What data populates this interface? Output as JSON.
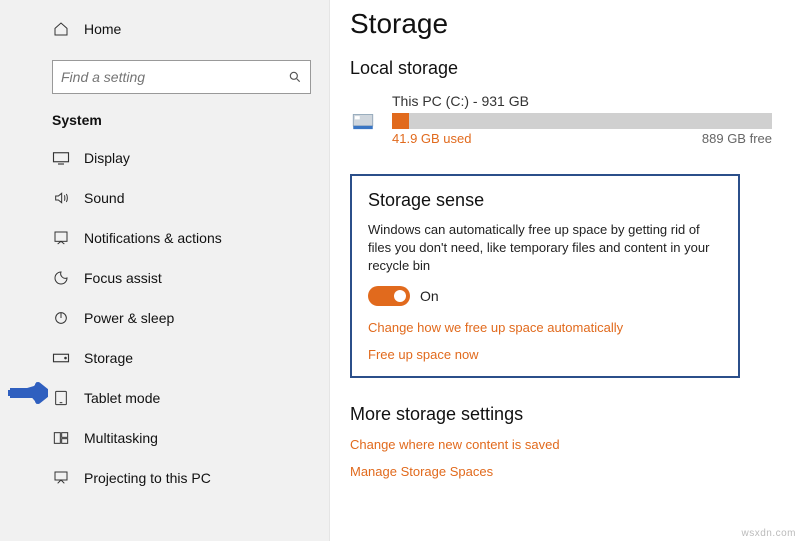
{
  "sidebar": {
    "home": "Home",
    "search_placeholder": "Find a setting",
    "section": "System",
    "items": [
      {
        "label": "Display"
      },
      {
        "label": "Sound"
      },
      {
        "label": "Notifications & actions"
      },
      {
        "label": "Focus assist"
      },
      {
        "label": "Power & sleep"
      },
      {
        "label": "Storage"
      },
      {
        "label": "Tablet mode"
      },
      {
        "label": "Multitasking"
      },
      {
        "label": "Projecting to this PC"
      }
    ]
  },
  "main": {
    "title": "Storage",
    "local_heading": "Local storage",
    "drive": {
      "name": "This PC (C:) - 931 GB",
      "used_label": "41.9 GB used",
      "free_label": "889 GB free",
      "used_pct": 4.5
    },
    "sense": {
      "heading": "Storage sense",
      "desc": "Windows can automatically free up space by getting rid of files you don't need, like temporary files and content in your recycle bin",
      "toggle_state": "On",
      "link_change": "Change how we free up space automatically",
      "link_free": "Free up space now"
    },
    "more": {
      "heading": "More storage settings",
      "link_change_save": "Change where new content is saved",
      "link_manage": "Manage Storage Spaces"
    }
  },
  "watermark": "wsxdn.com"
}
